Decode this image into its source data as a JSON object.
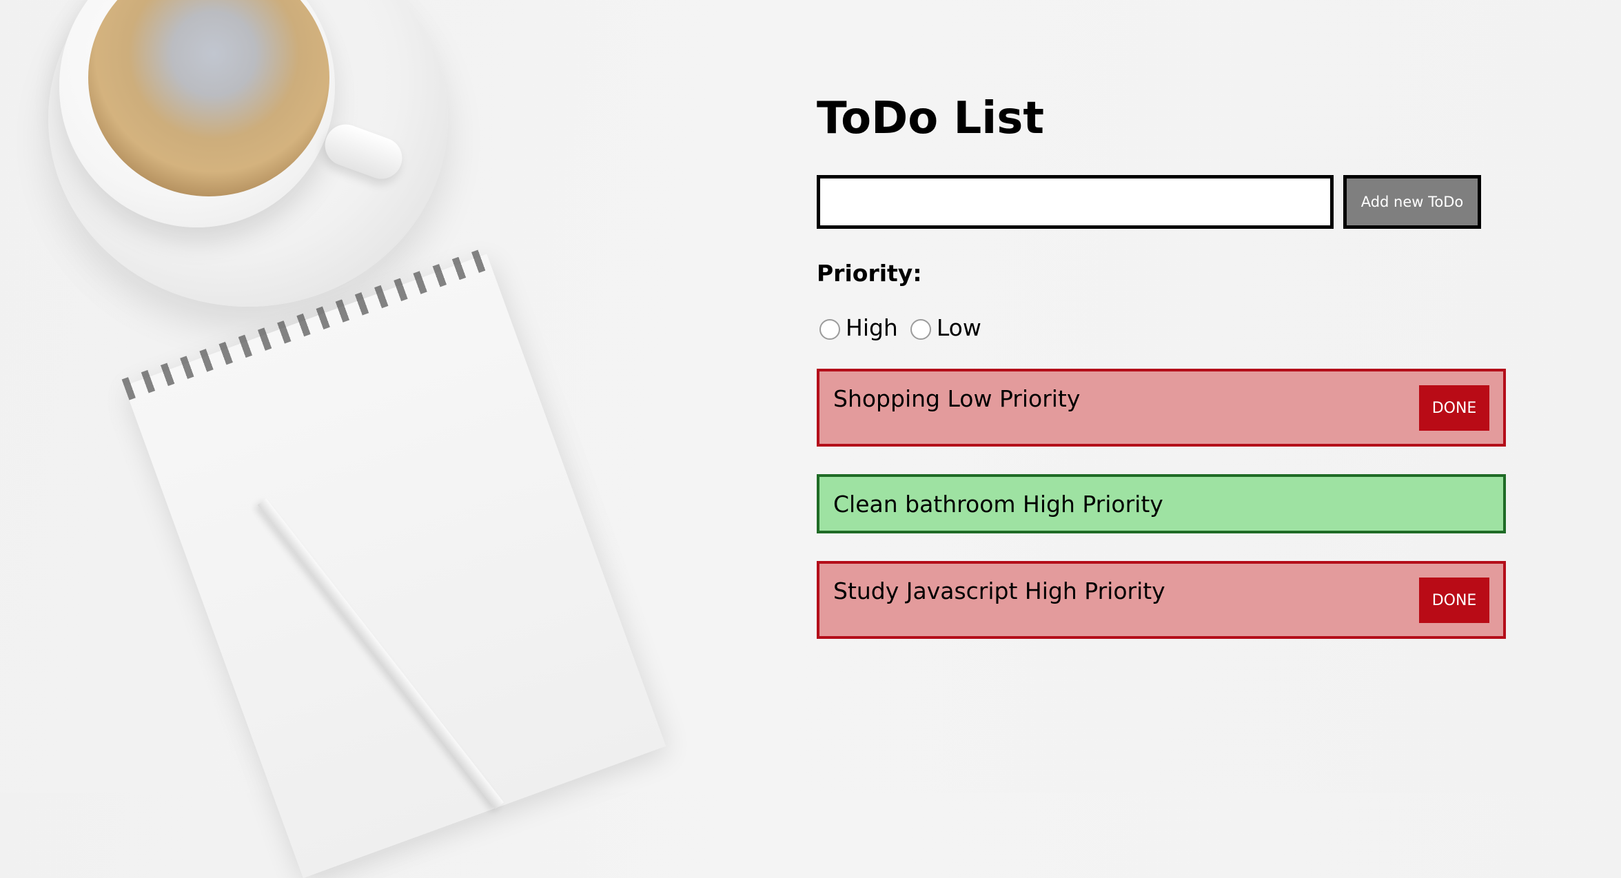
{
  "app": {
    "title": "ToDo List",
    "input": {
      "value": "",
      "placeholder": ""
    },
    "add_button_label": "Add new ToDo",
    "priority_label": "Priority:",
    "priority_options": [
      "High",
      "Low"
    ]
  },
  "todos": [
    {
      "text": "Shopping Low Priority",
      "done_label": "DONE",
      "status": "pending"
    },
    {
      "text": "Clean bathroom High Priority",
      "status": "completed"
    },
    {
      "text": "Study Javascript High Priority",
      "done_label": "DONE",
      "status": "pending"
    }
  ],
  "colors": {
    "pending_bg": "#e39b9c",
    "pending_border": "#b40e1a",
    "completed_bg": "#9ee2a2",
    "completed_border": "#1f6b26",
    "done_button": "#b90b16",
    "add_button": "#7f7f7f"
  }
}
